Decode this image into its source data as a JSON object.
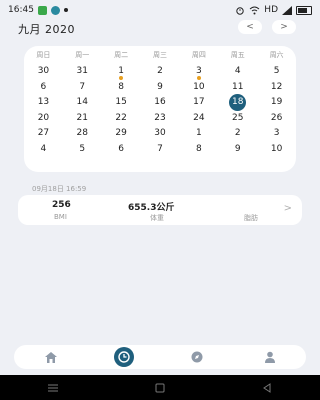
{
  "status_bar": {
    "time": "16:45",
    "network_label": "HD"
  },
  "header": {
    "month_year": "九月  2020",
    "prev_label": "<",
    "next_label": ">"
  },
  "calendar": {
    "weekdays": [
      "周日",
      "周一",
      "周二",
      "周三",
      "周四",
      "周五",
      "周六"
    ],
    "weeks": [
      [
        "30",
        "31",
        "1",
        "2",
        "3",
        "4",
        "5"
      ],
      [
        "6",
        "7",
        "8",
        "9",
        "10",
        "11",
        "12"
      ],
      [
        "13",
        "14",
        "15",
        "16",
        "17",
        "18",
        "19"
      ],
      [
        "20",
        "21",
        "22",
        "23",
        "24",
        "25",
        "26"
      ],
      [
        "27",
        "28",
        "29",
        "30",
        "1",
        "2",
        "3"
      ],
      [
        "4",
        "5",
        "6",
        "7",
        "8",
        "9",
        "10"
      ]
    ],
    "dot_days": [
      "1",
      "3"
    ],
    "selected_day": "18"
  },
  "record": {
    "timestamp": "09月18日 16:59",
    "bmi_value": "256",
    "bmi_label": "BMI",
    "weight_value": "655.3公斤",
    "weight_label": "体重",
    "fat_label": "脂肪",
    "chevron": ">"
  },
  "bottom_nav": {
    "items": [
      {
        "icon": "home-icon",
        "active": false
      },
      {
        "icon": "clock-icon",
        "active": true
      },
      {
        "icon": "compass-icon",
        "active": false
      },
      {
        "icon": "user-icon",
        "active": false
      }
    ]
  },
  "colors": {
    "accent": "#1f5f7d",
    "dot": "#e8a020",
    "background": "#eef0f5"
  }
}
